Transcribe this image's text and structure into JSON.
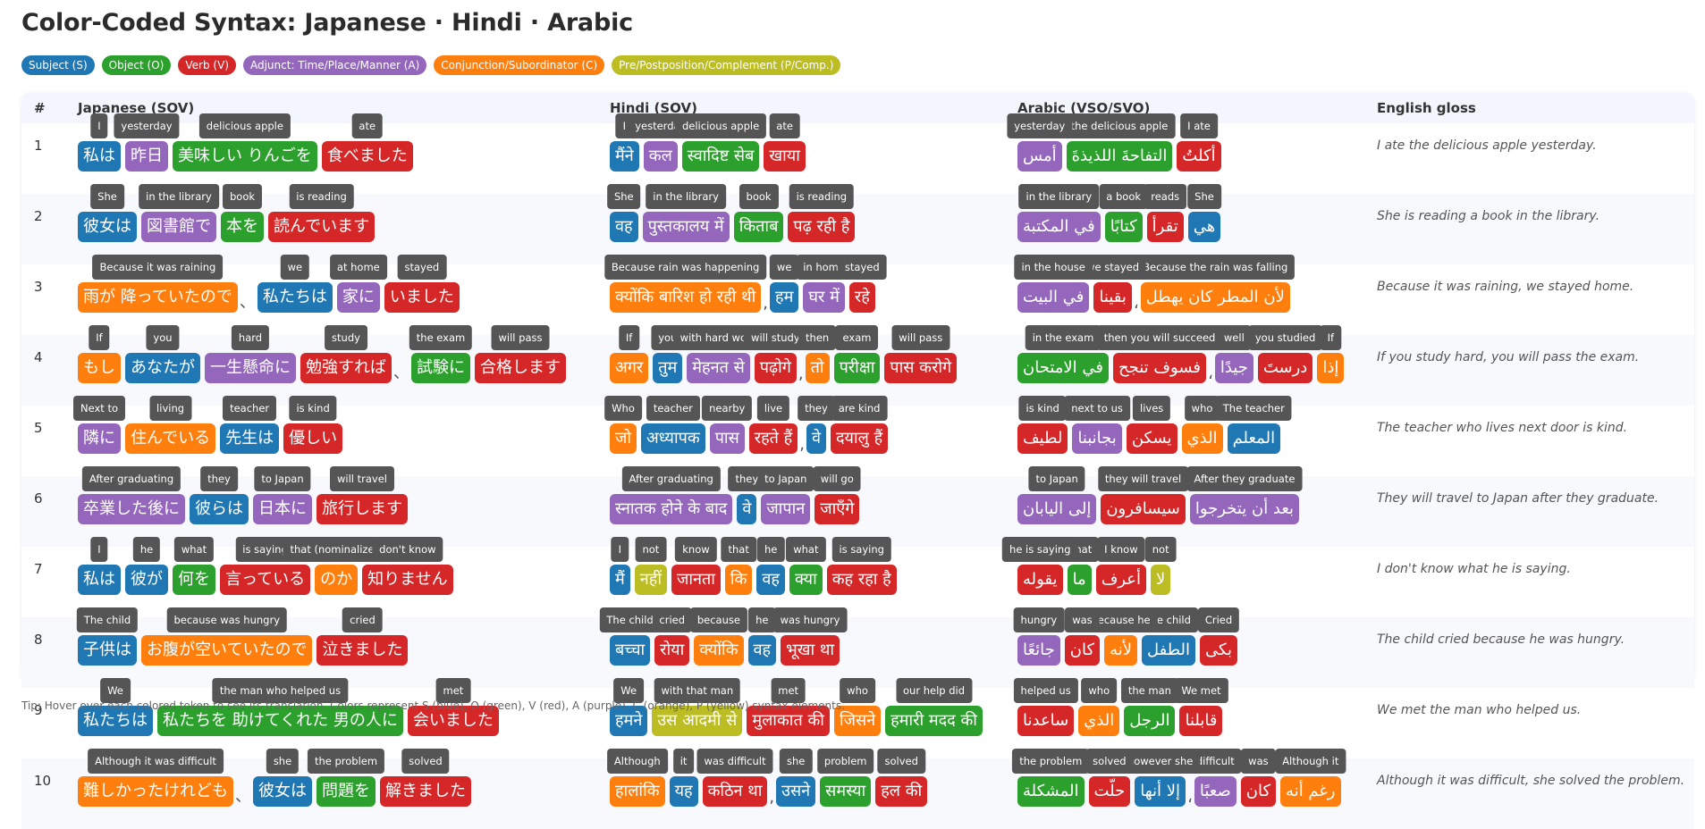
{
  "title": "Color-Coded Syntax: Japanese · Hindi · Arabic",
  "legend": [
    {
      "role": "S",
      "label": "Subject (S)",
      "color": "#1f77b4"
    },
    {
      "role": "O",
      "label": "Object (O)",
      "color": "#2ca02c"
    },
    {
      "role": "V",
      "label": "Verb (V)",
      "color": "#d62728"
    },
    {
      "role": "A",
      "label": "Adjunct: Time/Place/Manner (A)",
      "color": "#9467bd"
    },
    {
      "role": "C",
      "label": "Conjunction/Subordinator (C)",
      "color": "#ff7f0e"
    },
    {
      "role": "P",
      "label": "Pre/Postposition/Complement (P/Comp.)",
      "color": "#bcbd22"
    }
  ],
  "headers": [
    "#",
    "Japanese (SOV)",
    "Hindi (SOV)",
    "Arabic (VSO/SVO)",
    "English gloss"
  ],
  "rows": [
    {
      "num": "1",
      "japanese": [
        {
          "t": "私は",
          "r": "S",
          "g": "I"
        },
        {
          "t": "昨日",
          "r": "A",
          "g": "yesterday"
        },
        {
          "t": "美味しい りんごを",
          "r": "O",
          "g": "delicious apple"
        },
        {
          "t": "食べました",
          "r": "V",
          "g": "ate"
        }
      ],
      "hindi": [
        {
          "t": "मैंने",
          "r": "S",
          "g": "I"
        },
        {
          "t": "कल",
          "r": "A",
          "g": "yesterday"
        },
        {
          "t": "स्वादिष्ट सेब",
          "r": "O",
          "g": "delicious apple"
        },
        {
          "t": "खाया",
          "r": "V",
          "g": "ate"
        }
      ],
      "arabic": [
        {
          "t": "أكلتُ",
          "r": "V",
          "g": "I ate"
        },
        {
          "t": "التفاحةَ اللذيذةَ",
          "r": "O",
          "g": "the delicious apple"
        },
        {
          "t": "أمس",
          "r": "A",
          "g": "yesterday"
        }
      ],
      "gloss": "I ate the delicious apple yesterday."
    },
    {
      "num": "2",
      "japanese": [
        {
          "t": "彼女は",
          "r": "S",
          "g": "She"
        },
        {
          "t": "図書館で",
          "r": "A",
          "g": "in the library"
        },
        {
          "t": "本を",
          "r": "O",
          "g": "book"
        },
        {
          "t": "読んでいます",
          "r": "V",
          "g": "is reading"
        }
      ],
      "hindi": [
        {
          "t": "वह",
          "r": "S",
          "g": "She"
        },
        {
          "t": "पुस्तकालय में",
          "r": "A",
          "g": "in the library"
        },
        {
          "t": "किताब",
          "r": "O",
          "g": "book"
        },
        {
          "t": "पढ़ रही है",
          "r": "V",
          "g": "is reading"
        }
      ],
      "arabic": [
        {
          "t": "هي",
          "r": "S",
          "g": "She"
        },
        {
          "t": "تقرأ",
          "r": "V",
          "g": "reads"
        },
        {
          "t": "كتابًا",
          "r": "O",
          "g": "a book"
        },
        {
          "t": "في المكتبة",
          "r": "A",
          "g": "in the library"
        }
      ],
      "gloss": "She is reading a book in the library."
    },
    {
      "num": "3",
      "japanese": [
        {
          "t": "雨が 降っていたので",
          "r": "C",
          "g": "Because it was raining"
        },
        {
          "p": "、"
        },
        {
          "t": "私たちは",
          "r": "S",
          "g": "we"
        },
        {
          "t": "家に",
          "r": "A",
          "g": "at home"
        },
        {
          "t": "いました",
          "r": "V",
          "g": "stayed"
        }
      ],
      "hindi": [
        {
          "t": "क्योंकि बारिश हो रही थी",
          "r": "C",
          "g": "Because rain was happening"
        },
        {
          "p": ","
        },
        {
          "t": "हम",
          "r": "S",
          "g": "we"
        },
        {
          "t": "घर में",
          "r": "A",
          "g": "in home"
        },
        {
          "t": "रहे",
          "r": "V",
          "g": "stayed"
        }
      ],
      "arabic": [
        {
          "t": "لأن المطر كان يهطل",
          "r": "C",
          "g": "Because the rain was falling"
        },
        {
          "p": "،"
        },
        {
          "t": "بقينا",
          "r": "V",
          "g": "we stayed"
        },
        {
          "t": "في البيت",
          "r": "A",
          "g": "in the house"
        }
      ],
      "gloss": "Because it was raining, we stayed home."
    },
    {
      "num": "4",
      "japanese": [
        {
          "t": "もし",
          "r": "C",
          "g": "If"
        },
        {
          "t": "あなたが",
          "r": "S",
          "g": "you"
        },
        {
          "t": "一生懸命に",
          "r": "A",
          "g": "hard"
        },
        {
          "t": "勉強すれば",
          "r": "V",
          "g": "study"
        },
        {
          "p": "、"
        },
        {
          "t": "試験に",
          "r": "O",
          "g": "the exam"
        },
        {
          "t": "合格します",
          "r": "V",
          "g": "will pass"
        }
      ],
      "hindi": [
        {
          "t": "अगर",
          "r": "C",
          "g": "If"
        },
        {
          "t": "तुम",
          "r": "S",
          "g": "you"
        },
        {
          "t": "मेहनत से",
          "r": "A",
          "g": "with hard work"
        },
        {
          "t": "पढ़ोगे",
          "r": "V",
          "g": "will study"
        },
        {
          "p": ","
        },
        {
          "t": "तो",
          "r": "C",
          "g": "then"
        },
        {
          "t": "परीक्षा",
          "r": "O",
          "g": "exam"
        },
        {
          "t": "पास करोगे",
          "r": "V",
          "g": "will pass"
        }
      ],
      "arabic": [
        {
          "t": "إذا",
          "r": "C",
          "g": "If"
        },
        {
          "t": "درستَ",
          "r": "V",
          "g": "you studied"
        },
        {
          "t": "جيدًا",
          "r": "A",
          "g": "well"
        },
        {
          "p": "،"
        },
        {
          "t": "فسوف تنجح",
          "r": "V",
          "g": "then you will succeed"
        },
        {
          "t": "في الامتحان",
          "r": "O",
          "g": "in the exam"
        }
      ],
      "gloss": "If you study hard, you will pass the exam."
    },
    {
      "num": "5",
      "japanese": [
        {
          "t": "隣に",
          "r": "A",
          "g": "Next to"
        },
        {
          "t": "住んでいる",
          "r": "C",
          "g": "living"
        },
        {
          "t": "先生は",
          "r": "S",
          "g": "teacher"
        },
        {
          "t": "優しい",
          "r": "V",
          "g": "is kind"
        }
      ],
      "hindi": [
        {
          "t": "जो",
          "r": "C",
          "g": "Who"
        },
        {
          "t": "अध्यापक",
          "r": "S",
          "g": "teacher"
        },
        {
          "t": "पास",
          "r": "A",
          "g": "nearby"
        },
        {
          "t": "रहते हैं",
          "r": "V",
          "g": "live"
        },
        {
          "p": ","
        },
        {
          "t": "वे",
          "r": "S",
          "g": "they"
        },
        {
          "t": "दयालु हैं",
          "r": "V",
          "g": "are kind"
        }
      ],
      "arabic": [
        {
          "t": "المعلم",
          "r": "S",
          "g": "The teacher"
        },
        {
          "t": "الذي",
          "r": "C",
          "g": "who"
        },
        {
          "t": "يسكن",
          "r": "V",
          "g": "lives"
        },
        {
          "t": "بجانبنا",
          "r": "A",
          "g": "next to us"
        },
        {
          "t": "لطيف",
          "r": "V",
          "g": "is kind"
        }
      ],
      "gloss": "The teacher who lives next door is kind."
    },
    {
      "num": "6",
      "japanese": [
        {
          "t": "卒業した後に",
          "r": "A",
          "g": "After graduating"
        },
        {
          "t": "彼らは",
          "r": "S",
          "g": "they"
        },
        {
          "t": "日本に",
          "r": "A",
          "g": "to Japan"
        },
        {
          "t": "旅行します",
          "r": "V",
          "g": "will travel"
        }
      ],
      "hindi": [
        {
          "t": "स्नातक होने के बाद",
          "r": "A",
          "g": "After graduating"
        },
        {
          "t": "वे",
          "r": "S",
          "g": "they"
        },
        {
          "t": "जापान",
          "r": "A",
          "g": "to Japan"
        },
        {
          "t": "जाएँगे",
          "r": "V",
          "g": "will go"
        }
      ],
      "arabic": [
        {
          "t": "بعد أن يتخرجوا",
          "r": "A",
          "g": "After they graduate"
        },
        {
          "t": "سيسافرون",
          "r": "V",
          "g": "they will travel"
        },
        {
          "t": "إلى اليابان",
          "r": "A",
          "g": "to Japan"
        }
      ],
      "gloss": "They will travel to Japan after they graduate."
    },
    {
      "num": "7",
      "japanese": [
        {
          "t": "私は",
          "r": "S",
          "g": "I"
        },
        {
          "t": "彼が",
          "r": "S",
          "g": "he"
        },
        {
          "t": "何を",
          "r": "O",
          "g": "what"
        },
        {
          "t": "言っている",
          "r": "V",
          "g": "is saying"
        },
        {
          "t": "のか",
          "r": "C",
          "g": "that (nominalizer)"
        },
        {
          "t": "知りません",
          "r": "V",
          "g": "don't know"
        }
      ],
      "hindi": [
        {
          "t": "मैं",
          "r": "S",
          "g": "I"
        },
        {
          "t": "नहीं",
          "r": "P",
          "g": "not"
        },
        {
          "t": "जानता",
          "r": "V",
          "g": "know"
        },
        {
          "t": "कि",
          "r": "C",
          "g": "that"
        },
        {
          "t": "वह",
          "r": "S",
          "g": "he"
        },
        {
          "t": "क्या",
          "r": "O",
          "g": "what"
        },
        {
          "t": "कह रहा है",
          "r": "V",
          "g": "is saying"
        }
      ],
      "arabic": [
        {
          "t": "لا",
          "r": "P",
          "g": "not"
        },
        {
          "t": "أعرف",
          "r": "V",
          "g": "I know"
        },
        {
          "t": "ما",
          "r": "O",
          "g": "what"
        },
        {
          "t": "يقوله",
          "r": "V",
          "g": "he is saying"
        }
      ],
      "gloss": "I don't know what he is saying."
    },
    {
      "num": "8",
      "japanese": [
        {
          "t": "子供は",
          "r": "S",
          "g": "The child"
        },
        {
          "t": "お腹が空いていたので",
          "r": "C",
          "g": "because was hungry"
        },
        {
          "t": "泣きました",
          "r": "V",
          "g": "cried"
        }
      ],
      "hindi": [
        {
          "t": "बच्चा",
          "r": "S",
          "g": "The child"
        },
        {
          "t": "रोया",
          "r": "V",
          "g": "cried"
        },
        {
          "t": "क्योंकि",
          "r": "C",
          "g": "because"
        },
        {
          "t": "वह",
          "r": "S",
          "g": "he"
        },
        {
          "t": "भूखा था",
          "r": "V",
          "g": "was hungry"
        }
      ],
      "arabic": [
        {
          "t": "بكى",
          "r": "V",
          "g": "Cried"
        },
        {
          "t": "الطفل",
          "r": "S",
          "g": "the child"
        },
        {
          "t": "لأنه",
          "r": "C",
          "g": "because he"
        },
        {
          "t": "كان",
          "r": "V",
          "g": "was"
        },
        {
          "t": "جائعًا",
          "r": "A",
          "g": "hungry"
        }
      ],
      "gloss": "The child cried because he was hungry."
    },
    {
      "num": "9",
      "japanese": [
        {
          "t": "私たちは",
          "r": "S",
          "g": "We"
        },
        {
          "t": "私たちを 助けてくれた 男の人に",
          "r": "O",
          "g": "the man who helped us"
        },
        {
          "t": "会いました",
          "r": "V",
          "g": "met"
        }
      ],
      "hindi": [
        {
          "t": "हमने",
          "r": "S",
          "g": "We"
        },
        {
          "t": "उस आदमी से",
          "r": "P",
          "g": "with that man"
        },
        {
          "t": "मुलाकात की",
          "r": "V",
          "g": "met"
        },
        {
          "t": "जिसने",
          "r": "C",
          "g": "who"
        },
        {
          "t": "हमारी मदद की",
          "r": "O",
          "g": "our help did"
        }
      ],
      "arabic": [
        {
          "t": "قابلنا",
          "r": "V",
          "g": "We met"
        },
        {
          "t": "الرجل",
          "r": "O",
          "g": "the man"
        },
        {
          "t": "الذي",
          "r": "C",
          "g": "who"
        },
        {
          "t": "ساعدنا",
          "r": "V",
          "g": "helped us"
        }
      ],
      "gloss": "We met the man who helped us."
    },
    {
      "num": "10",
      "japanese": [
        {
          "t": "難しかったけれども",
          "r": "C",
          "g": "Although it was difficult"
        },
        {
          "p": "、"
        },
        {
          "t": "彼女は",
          "r": "S",
          "g": "she"
        },
        {
          "t": "問題を",
          "r": "O",
          "g": "the problem"
        },
        {
          "t": "解きました",
          "r": "V",
          "g": "solved"
        }
      ],
      "hindi": [
        {
          "t": "हालांकि",
          "r": "C",
          "g": "Although"
        },
        {
          "t": "यह",
          "r": "S",
          "g": "it"
        },
        {
          "t": "कठिन था",
          "r": "V",
          "g": "was difficult"
        },
        {
          "p": ","
        },
        {
          "t": "उसने",
          "r": "S",
          "g": "she"
        },
        {
          "t": "समस्या",
          "r": "O",
          "g": "problem"
        },
        {
          "t": "हल की",
          "r": "V",
          "g": "solved"
        }
      ],
      "arabic": [
        {
          "t": "رغم أنه",
          "r": "C",
          "g": "Although it"
        },
        {
          "t": "كان",
          "r": "V",
          "g": "was"
        },
        {
          "t": "صعبًا",
          "r": "A",
          "g": "difficult"
        },
        {
          "p": "،"
        },
        {
          "t": "إلا أنها",
          "r": "S",
          "g": "however she"
        },
        {
          "t": "حلّت",
          "r": "V",
          "g": "solved"
        },
        {
          "t": "المشكلة",
          "r": "O",
          "g": "the problem"
        }
      ],
      "gloss": "Although it was difficult, she solved the problem."
    }
  ],
  "footer": "Tip: Hover over each colored token to see its translation. Colors represent S (blue), O (green), V (red), A (purple), C (orange), P (yellow) syntax elements."
}
